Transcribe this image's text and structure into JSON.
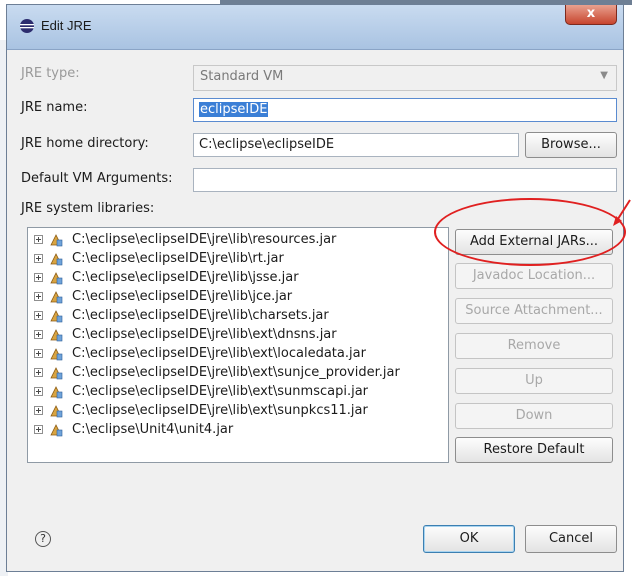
{
  "window": {
    "title": "Edit JRE",
    "close_label": "x"
  },
  "form": {
    "jre_type_label": "JRE type:",
    "jre_type_value": "Standard VM",
    "jre_name_label": "JRE name:",
    "jre_name_value": "eclipseIDE",
    "jre_home_label": "JRE home directory:",
    "jre_home_value": "C:\\eclipse\\eclipseIDE",
    "browse_label": "Browse...",
    "vm_args_label": "Default VM Arguments:",
    "vm_args_value": "",
    "libraries_label": "JRE system libraries:"
  },
  "libraries": [
    "C:\\eclipse\\eclipseIDE\\jre\\lib\\resources.jar",
    "C:\\eclipse\\eclipseIDE\\jre\\lib\\rt.jar",
    "C:\\eclipse\\eclipseIDE\\jre\\lib\\jsse.jar",
    "C:\\eclipse\\eclipseIDE\\jre\\lib\\jce.jar",
    "C:\\eclipse\\eclipseIDE\\jre\\lib\\charsets.jar",
    "C:\\eclipse\\eclipseIDE\\jre\\lib\\ext\\dnsns.jar",
    "C:\\eclipse\\eclipseIDE\\jre\\lib\\ext\\localedata.jar",
    "C:\\eclipse\\eclipseIDE\\jre\\lib\\ext\\sunjce_provider.jar",
    "C:\\eclipse\\eclipseIDE\\jre\\lib\\ext\\sunmscapi.jar",
    "C:\\eclipse\\eclipseIDE\\jre\\lib\\ext\\sunpkcs11.jar",
    "C:\\eclipse\\Unit4\\unit4.jar"
  ],
  "side_buttons": {
    "add_external_jars": "Add External JARs...",
    "javadoc_location": "Javadoc Location...",
    "source_attachment": "Source Attachment...",
    "remove": "Remove",
    "up": "Up",
    "down": "Down",
    "restore_default": "Restore Default"
  },
  "footer": {
    "help_glyph": "?",
    "ok_label": "OK",
    "cancel_label": "Cancel"
  },
  "colors": {
    "annotation": "#e02020",
    "selection": "#3b7fd6",
    "titlebar": "#b8cfea"
  }
}
